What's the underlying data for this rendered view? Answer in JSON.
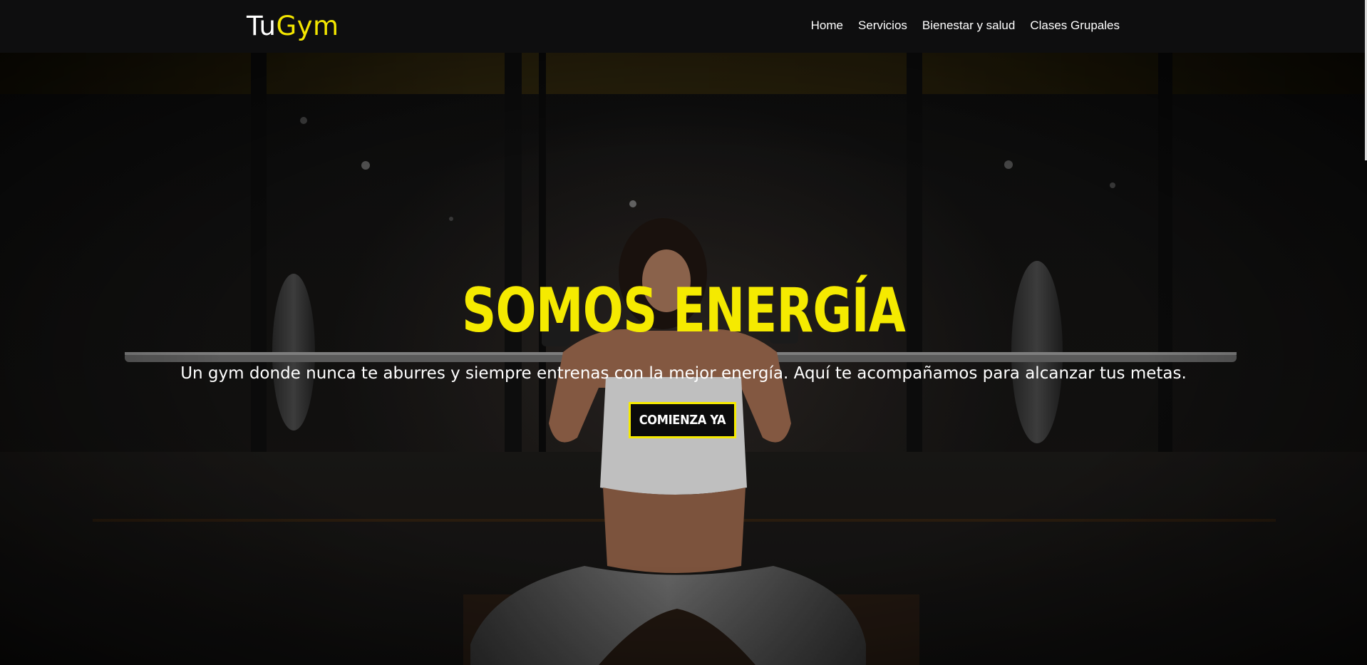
{
  "brand": {
    "logo_part1": "Tu",
    "logo_part2": "Gym",
    "accent_color": "#f3e600"
  },
  "nav": {
    "items": [
      {
        "label": "Home"
      },
      {
        "label": "Servicios"
      },
      {
        "label": "Bienestar y salud"
      },
      {
        "label": "Clases Grupales"
      }
    ]
  },
  "hero": {
    "headline": "SOMOS ENERGÍA",
    "subtitle": "Un gym donde nunca te aburres y siempre entrenas con la mejor energía. Aquí te acompañamos para alcanzar tus metas.",
    "cta_label": "COMIENZA YA",
    "background_icon": "weightlifter-photo"
  }
}
